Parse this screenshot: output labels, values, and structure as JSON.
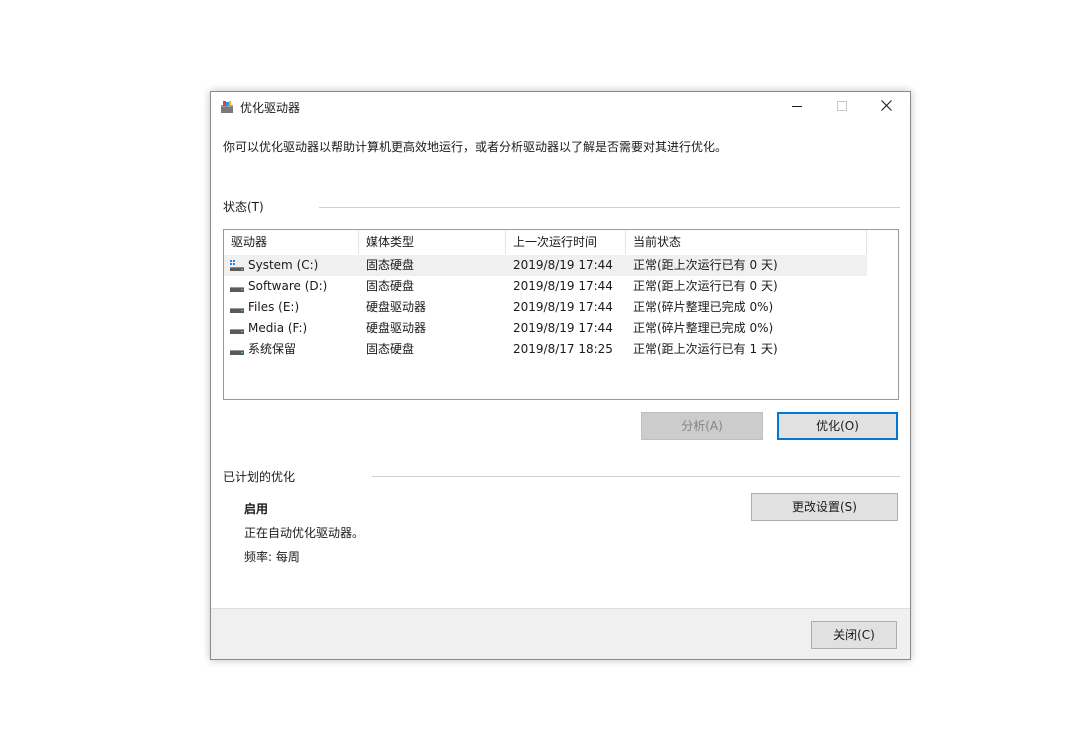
{
  "window": {
    "title": "优化驱动器",
    "minimize_icon": "minimize-icon",
    "maximize_icon": "maximize-icon",
    "close_icon": "close-icon"
  },
  "intro_text": "你可以优化驱动器以帮助计算机更高效地运行，或者分析驱动器以了解是否需要对其进行优化。",
  "status_section": {
    "label": "状态(T)",
    "columns": [
      "驱动器",
      "媒体类型",
      "上一次运行时间",
      "当前状态"
    ],
    "rows": [
      {
        "drive": "System (C:)",
        "icon": "system-drive-icon",
        "media": "固态硬盘",
        "last_run": "2019/8/19 17:44",
        "status": "正常(距上次运行已有 0 天)",
        "selected": true
      },
      {
        "drive": "Software (D:)",
        "icon": "drive-icon",
        "media": "固态硬盘",
        "last_run": "2019/8/19 17:44",
        "status": "正常(距上次运行已有 0 天)",
        "selected": false
      },
      {
        "drive": "Files (E:)",
        "icon": "drive-icon",
        "media": "硬盘驱动器",
        "last_run": "2019/8/19 17:44",
        "status": "正常(碎片整理已完成 0%)",
        "selected": false
      },
      {
        "drive": "Media (F:)",
        "icon": "drive-icon",
        "media": "硬盘驱动器",
        "last_run": "2019/8/19 17:44",
        "status": "正常(碎片整理已完成 0%)",
        "selected": false
      },
      {
        "drive": "系统保留",
        "icon": "drive-icon",
        "media": "固态硬盘",
        "last_run": "2019/8/17 18:25",
        "status": "正常(距上次运行已有 1 天)",
        "selected": false
      }
    ]
  },
  "buttons": {
    "analyze": "分析(A)",
    "optimize": "优化(O)",
    "change_settings": "更改设置(S)",
    "close": "关闭(C)"
  },
  "schedule_section": {
    "label": "已计划的优化",
    "state": "启用",
    "description": "正在自动优化驱动器。",
    "frequency": "频率: 每周"
  },
  "colors": {
    "accent": "#0078d7",
    "selected_row": "#f0f0f0",
    "footer": "#f0f0f0"
  }
}
